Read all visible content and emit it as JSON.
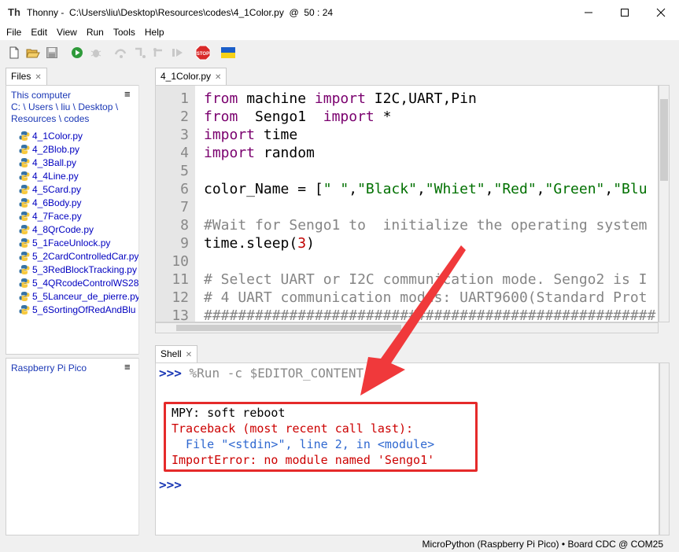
{
  "window": {
    "app_name": "Thonny",
    "path": "C:\\Users\\liu\\Desktop\\Resources\\codes\\4_1Color.py",
    "separator": "@",
    "cursor": "50 : 24"
  },
  "menu": [
    "File",
    "Edit",
    "View",
    "Run",
    "Tools",
    "Help"
  ],
  "toolbar_icons": [
    "new-file-icon",
    "open-file-icon",
    "save-icon",
    "run-icon",
    "debug-icon",
    "step-over-icon",
    "step-into-icon",
    "step-out-icon",
    "resume-icon",
    "stop-icon",
    "ukraine-flag-icon"
  ],
  "files_panel": {
    "tab_label": "Files",
    "location_title": "This computer",
    "path_line1": "C: \\ Users \\ liu \\ Desktop \\",
    "path_line2": "Resources \\ codes",
    "menu_glyph": "≡",
    "files": [
      "4_1Color.py",
      "4_2Blob.py",
      "4_3Ball.py",
      "4_4Line.py",
      "4_5Card.py",
      "4_6Body.py",
      "4_7Face.py",
      "4_8QrCode.py",
      "5_1FaceUnlock.py",
      "5_2CardControlledCar.py",
      "5_3RedBlockTracking.py",
      "5_4QRcodeControlWS28",
      "5_5Lanceur_de_pierre.py",
      "5_6SortingOfRedAndBlu"
    ]
  },
  "device_panel": {
    "title": "Raspberry Pi Pico",
    "menu_glyph": "≡"
  },
  "editor": {
    "tab_label": "4_1Color.py",
    "line_numbers": [
      "1",
      "2",
      "3",
      "4",
      "5",
      "6",
      "7",
      "8",
      "9",
      "10",
      "11",
      "12",
      "13"
    ],
    "l1": {
      "kw1": "from",
      "t1": " machine ",
      "kw2": "import",
      "t2": " I2C,UART,Pin"
    },
    "l2": {
      "kw1": "from",
      "t1": "  Sengo1  ",
      "kw2": "import",
      "t2": " *"
    },
    "l3": {
      "kw1": "import",
      "t1": " time"
    },
    "l4": {
      "kw1": "import",
      "t1": " random"
    },
    "l6": {
      "t1": "color_Name = [",
      "s1": "\" \"",
      "c1": ",",
      "s2": "\"Black\"",
      "c2": ",",
      "s3": "\"Whiet\"",
      "c3": ",",
      "s4": "\"Red\"",
      "c4": ",",
      "s5": "\"Green\"",
      "c5": ",",
      "s6": "\"Blu"
    },
    "l8": "#Wait for Sengo1 to  initialize the operating system",
    "l9": {
      "t1": "time.sleep(",
      "n1": "3",
      "t2": ")"
    },
    "l11": "# Select UART or I2C communication mode. Sengo2 is I",
    "l12": "# 4 UART communication modes: UART9600(Standard Prot",
    "l13": "#####################################################"
  },
  "shell": {
    "tab_label": "Shell",
    "prompt": ">>>",
    "command": " %Run -c $EDITOR_CONTENT",
    "reboot": "MPY: soft reboot",
    "traceback": "Traceback (most recent call last):",
    "file_line": "  File \"<stdin>\", line 2, in <module>",
    "error": "ImportError: no module named 'Sengo1'"
  },
  "status": {
    "interpreter": "MicroPython (Raspberry Pi Pico)",
    "dot": "•",
    "port": "Board CDC @ COM25"
  },
  "colors": {
    "keyword": "#7a006e",
    "string": "#007000",
    "comment": "#858585",
    "number": "#c00000",
    "error": "#cc0000",
    "link": "#1a37b5",
    "annotation": "#e52a2a"
  }
}
